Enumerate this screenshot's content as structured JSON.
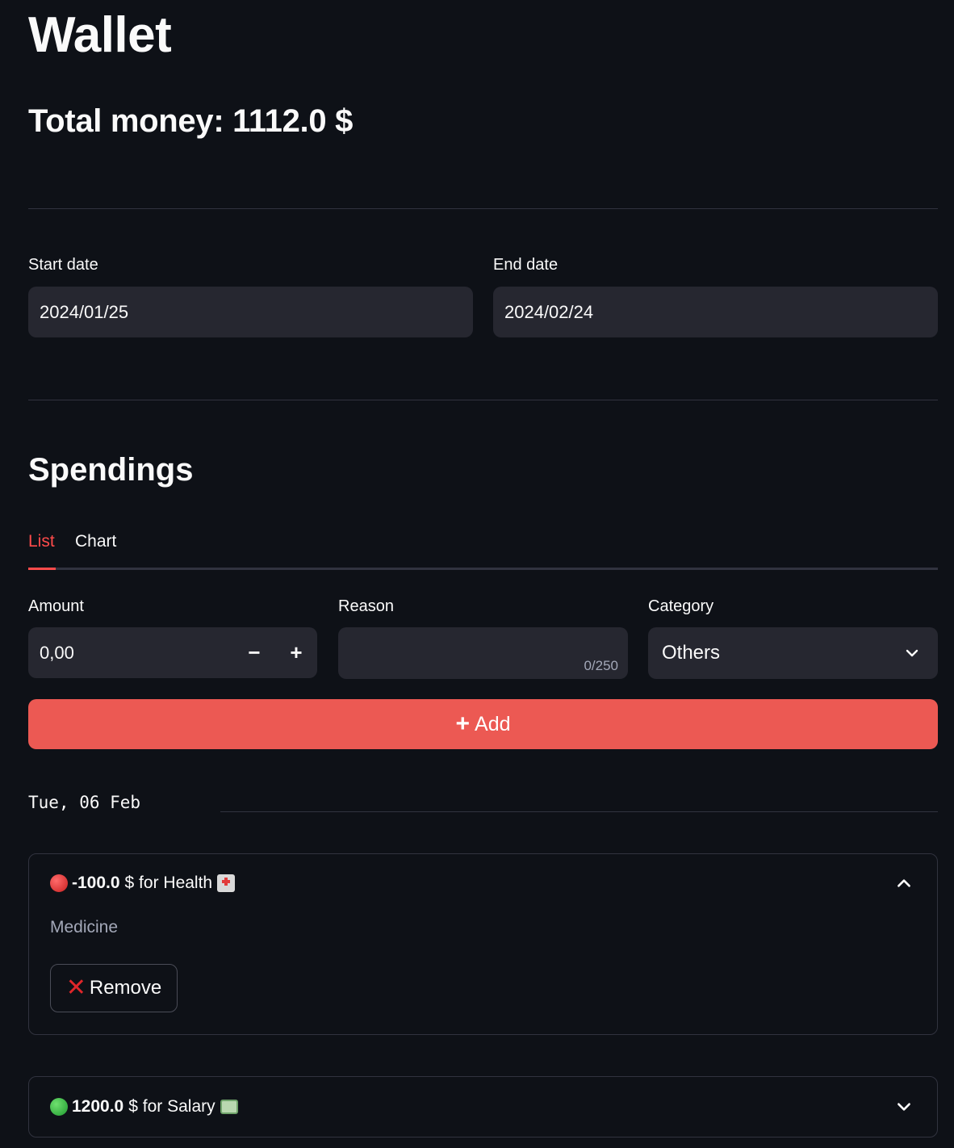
{
  "header": {
    "title": "Wallet",
    "total_money": "Total money: 1112.0 $"
  },
  "dates": {
    "start_label": "Start date",
    "start_value": "2024/01/25",
    "end_label": "End date",
    "end_value": "2024/02/24"
  },
  "spendings": {
    "title": "Spendings",
    "tabs": [
      {
        "label": "List",
        "active": true
      },
      {
        "label": "Chart",
        "active": false
      }
    ],
    "form": {
      "amount_label": "Amount",
      "amount_value": "0,00",
      "decrement": "−",
      "increment": "+",
      "reason_label": "Reason",
      "reason_value": "",
      "reason_counter": "0/250",
      "category_label": "Category",
      "category_value": "Others",
      "add_label": "Add"
    },
    "groups": [
      {
        "date": "Tue, 06 Feb",
        "entries": [
          {
            "status_icon": "red-circle-icon",
            "amount": "-100.0",
            "text": "$ for Health",
            "category_icon": "hospital-icon",
            "expanded": true,
            "reason": "Medicine",
            "remove_label": "Remove"
          },
          {
            "status_icon": "green-circle-icon",
            "amount": "1200.0",
            "text": "$ for Salary",
            "category_icon": "dollar-banknote-icon",
            "expanded": false
          }
        ]
      }
    ]
  },
  "colors": {
    "background": "#0e1117",
    "input_bg": "#262730",
    "accent": "#ff4b4b",
    "add_button": "#ec5953",
    "divider": "#31333f"
  }
}
